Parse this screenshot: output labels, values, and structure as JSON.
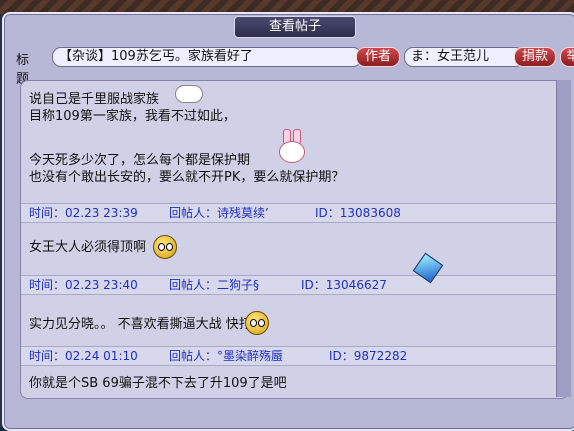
{
  "window": {
    "title": "查看帖子"
  },
  "header": {
    "title_label": "标题",
    "title_value": "【杂谈】109苏乞丐。家族看好了",
    "author_button": "作者",
    "author_value": "ま：女王范儿",
    "donate_button": "捐款",
    "extra_button": "举"
  },
  "posts": [
    {
      "lines": [
        "说自己是千里服战家族",
        "目称109第一家族，我看不过如此，",
        "",
        "今天死多少次了，怎么每个都是保护期",
        "  也没有个敢出长安的，要么就不开PK，要么就保护期？"
      ],
      "time": "时间：02.23 23:39",
      "replier": "回帖人：诗残莫续’",
      "id": "ID：13083608"
    },
    {
      "lines": [
        "女王大人必须得顶啊"
      ],
      "time": "时间：02.23 23:40",
      "replier": "回帖人：二狗子§",
      "id": "ID：13046627"
    },
    {
      "lines": [
        "实力见分晓。。 不喜欢看撕逼大战    快打吧"
      ],
      "time": "时间：02.24 01:10",
      "replier": "回帖人：°墨染醉殇蜃",
      "id": "ID：9872282"
    },
    {
      "lines": [
        "你就是个SB 69骗子混不下去了升109了是吧"
      ],
      "time": "",
      "replier": "",
      "id": ""
    }
  ],
  "colors": {
    "accent": "#1e2fbf",
    "button": "#b3282c",
    "panel": "#d0d0e6"
  }
}
